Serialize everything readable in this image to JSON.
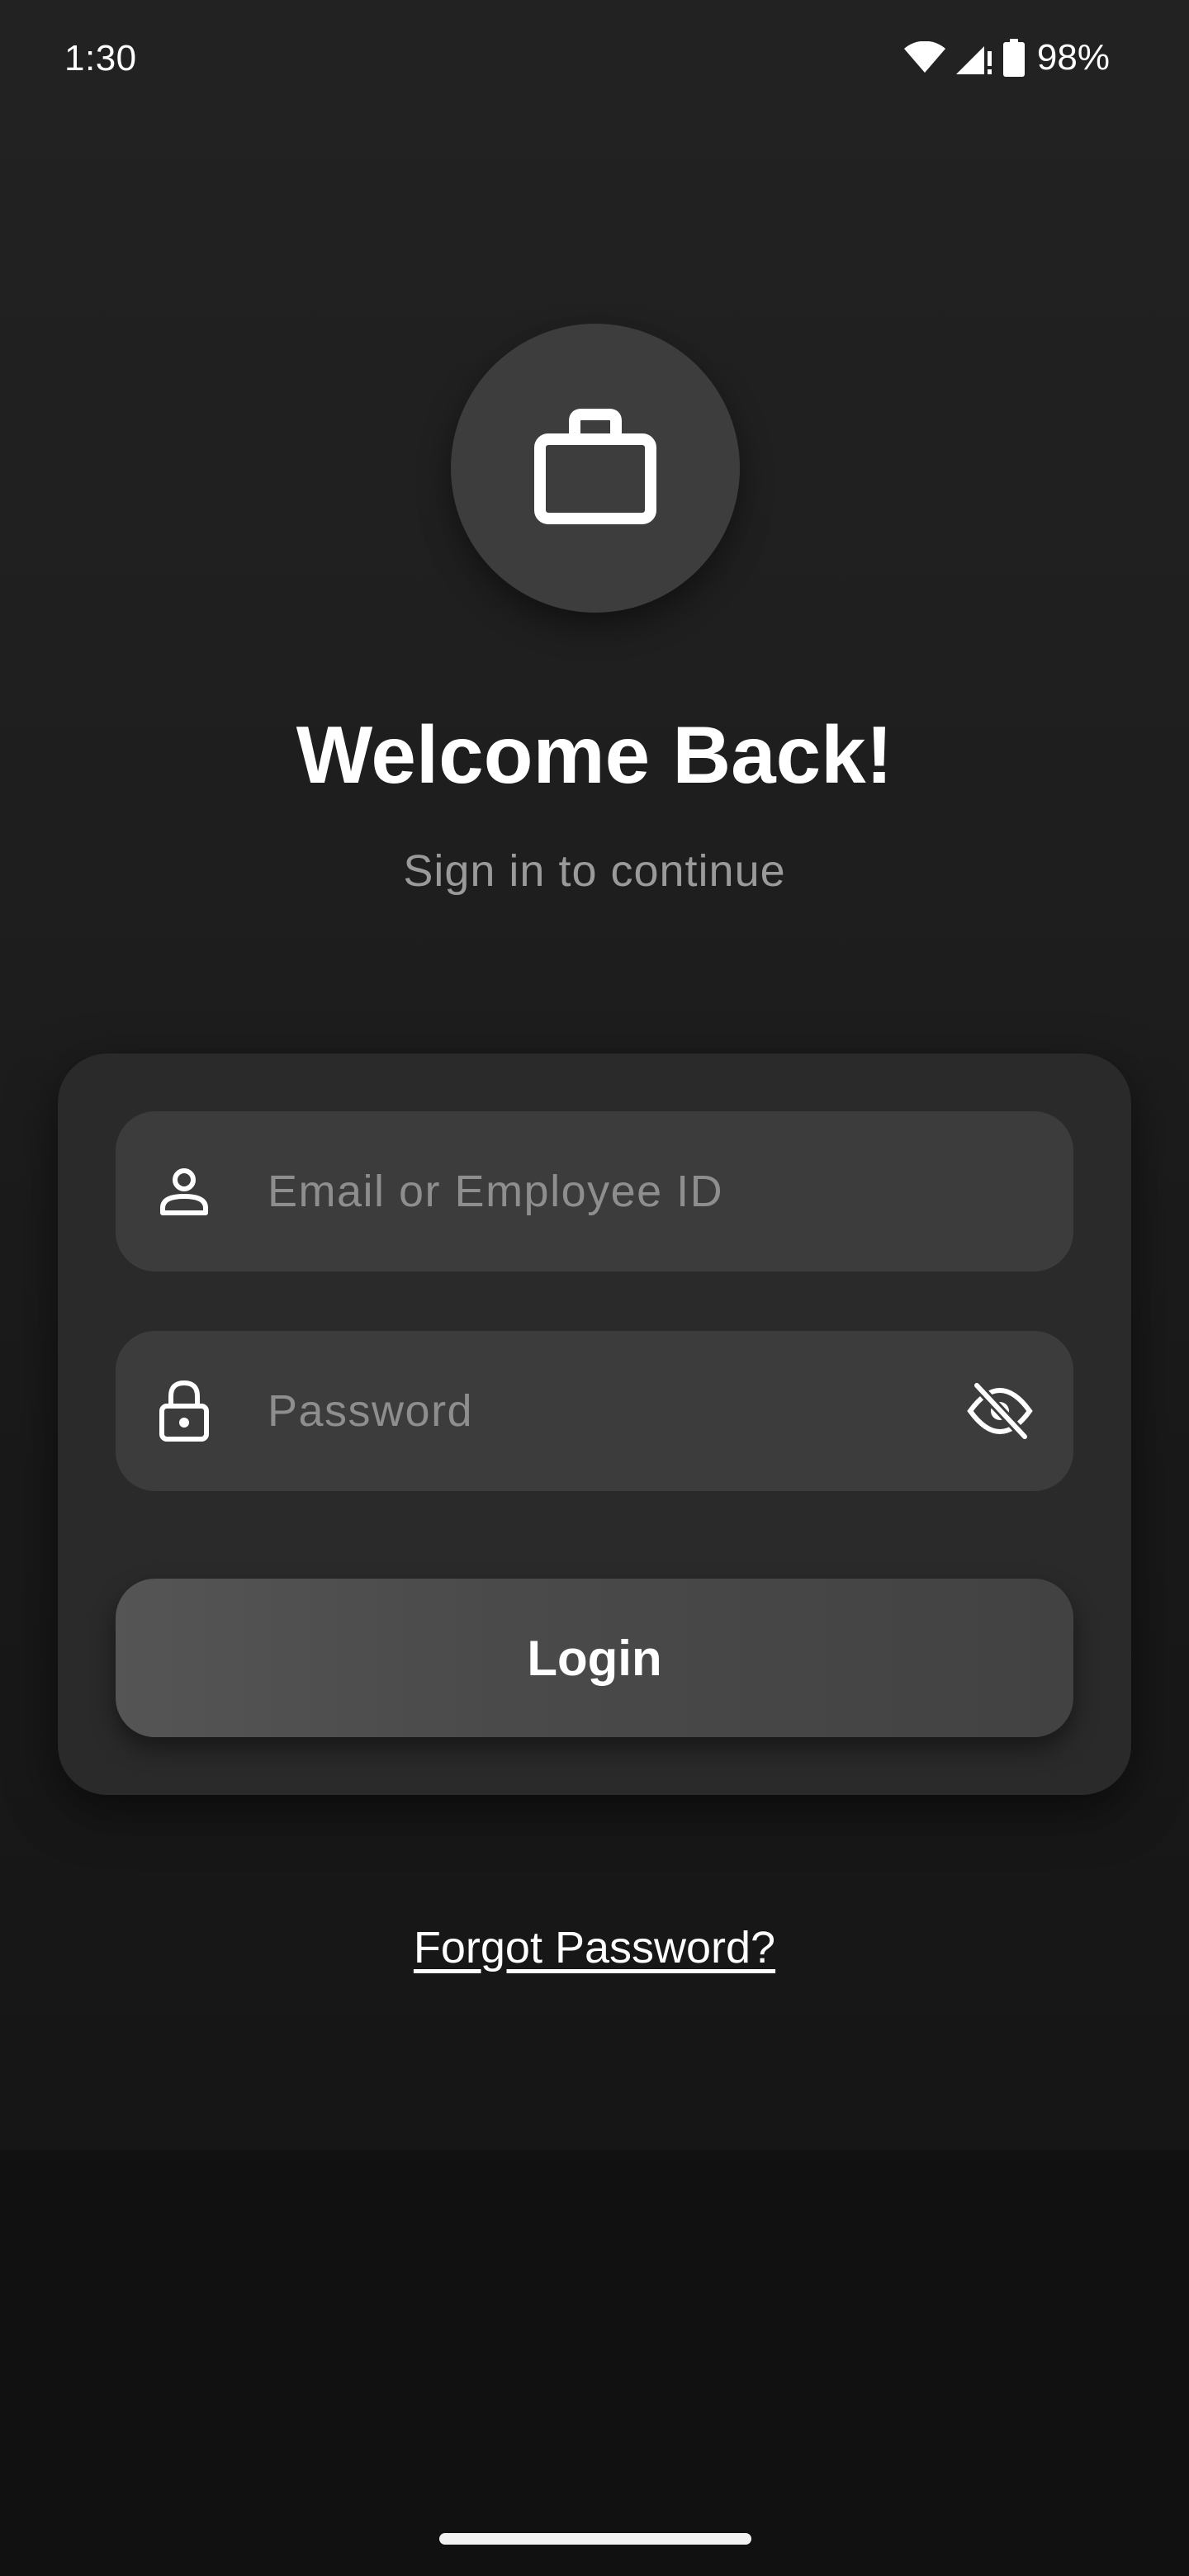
{
  "status_bar": {
    "time": "1:30",
    "battery": "98%",
    "icons": [
      "wifi-icon",
      "cell-signal-icon",
      "battery-icon"
    ]
  },
  "logo": {
    "icon": "briefcase-icon"
  },
  "header": {
    "title": "Welcome Back!",
    "subtitle": "Sign in to continue"
  },
  "form": {
    "email": {
      "icon": "person-icon",
      "value": "",
      "placeholder": "Email or Employee ID"
    },
    "password": {
      "icon": "lock-icon",
      "value": "",
      "placeholder": "Password",
      "toggle_icon": "eye-off-icon"
    },
    "login_label": "Login"
  },
  "forgot_password_label": "Forgot Password?",
  "colors": {
    "background": "#1e1e1e",
    "card": "#2a2a2a",
    "field": "#3c3c3c",
    "button": "#4a4a4a",
    "placeholder": "#8e8e8e",
    "subtitle": "#9a9a9a"
  }
}
